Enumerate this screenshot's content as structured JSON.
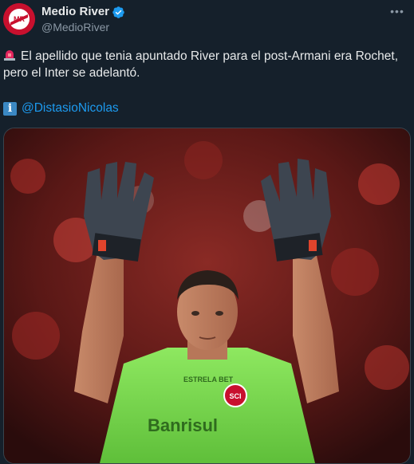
{
  "account": {
    "display_name": "Medio River",
    "handle": "@MedioRiver",
    "avatar_text": "MR"
  },
  "tweet": {
    "line1": "El apellido que tenia apuntado River para el post-Armani era Rochet,",
    "line2": "pero el Inter se adelantó.",
    "mention": "@DistasioNicolas",
    "info_glyph": "i"
  },
  "media": {
    "jersey_sponsor": "Banrisul",
    "jersey_brand": "ESTRELA BET",
    "alt_icon": "photo"
  },
  "colors": {
    "background": "#15202b",
    "link": "#1d9bf0",
    "verified": "#1d9bf0",
    "jersey": "#7ed957"
  },
  "icons": [
    "siren-icon",
    "info-icon",
    "verified-badge-icon",
    "more-options-icon"
  ]
}
